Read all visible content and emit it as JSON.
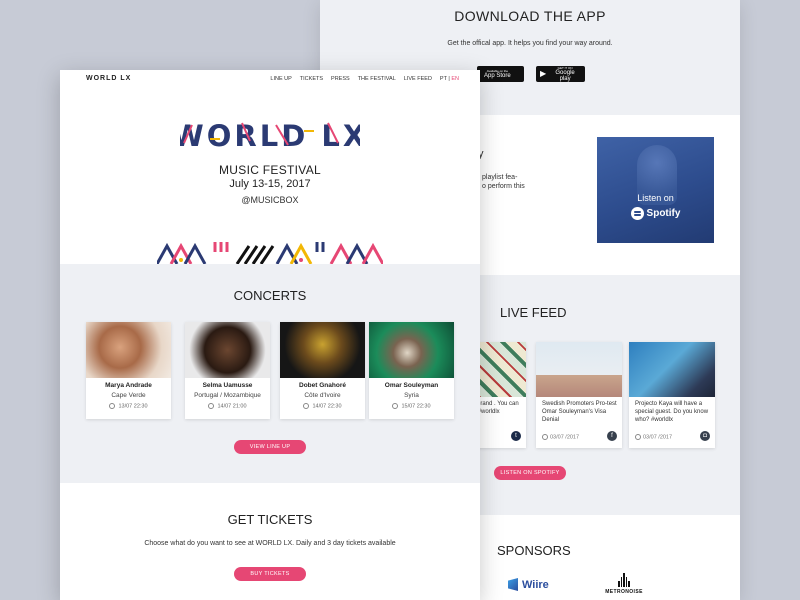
{
  "app": {
    "title": "DOWNLOAD THE APP",
    "subtitle": "Get the offical app. It helps you find your way around.",
    "appstore": {
      "small": "Available on the",
      "big": "App Store"
    },
    "googleplay": {
      "small": "GET IT ON",
      "big": "Google play"
    }
  },
  "spotify": {
    "frag_title": "y",
    "frag_lines": [
      "playlist fea-",
      "o perform this"
    ],
    "listen": "Listen on",
    "brand": "Spotify"
  },
  "feed": {
    "title": "LIVE FEED",
    "items": [
      {
        "text": "ocolate brand . You can try te at #worldlx",
        "date": "17",
        "network": "twitter-icon",
        "glyph": "t"
      },
      {
        "text": "Swedish Promoters Pro-test Omar Souleyman's Visa Denial",
        "date": "03/07 /2017",
        "network": "facebook-icon",
        "glyph": "f"
      },
      {
        "text": "Projecto Kaya will have a special guest. Do you know who? #worldlx",
        "date": "03/07 /2017",
        "network": "instagram-icon",
        "glyph": "◘"
      }
    ],
    "button": "LISTEN ON SPOTIFY"
  },
  "sponsors": {
    "title": "SPONSORS",
    "wiire": "Wiire",
    "metronoise": "METRONOISE"
  },
  "front": {
    "logo_small": "WORLD LX",
    "nav": [
      "LINE UP",
      "TICKETS",
      "PRESS",
      "THE FESTIVAL",
      "LIVE FEED"
    ],
    "lang_pt": "PT",
    "lang_sep": "|",
    "lang_en": "EN",
    "logo_big": "WORLD LX",
    "festival": "MUSIC FESTIVAL",
    "dates": "July 13-15, 2017",
    "handle": "@MUSICBOX"
  },
  "concerts": {
    "title": "CONCERTS",
    "artists": [
      {
        "name": "Marya Andrade",
        "country": "Cape Verde",
        "date": "13/07",
        "time": "22:30"
      },
      {
        "name": "Selma Uamusse",
        "country": "Portugal / Mozambique",
        "date": "14/07",
        "time": "21:00"
      },
      {
        "name": "Dobet Gnahoré",
        "country": "Côte d'Ivoire",
        "date": "14/07",
        "time": "22:30"
      },
      {
        "name": "Omar Souleyman",
        "country": "Syria",
        "date": "15/07",
        "time": "22:30"
      }
    ],
    "button": "VIEW LINE UP"
  },
  "tickets": {
    "title": "GET TICKETS",
    "subtitle": "Choose what do you want to see at WORLD LX. Daily and 3 day tickets available",
    "button": "BUY TICKETS"
  },
  "colors": {
    "accent": "#e64774",
    "navy": "#2b3a73",
    "section_bg": "#eef0f4"
  }
}
